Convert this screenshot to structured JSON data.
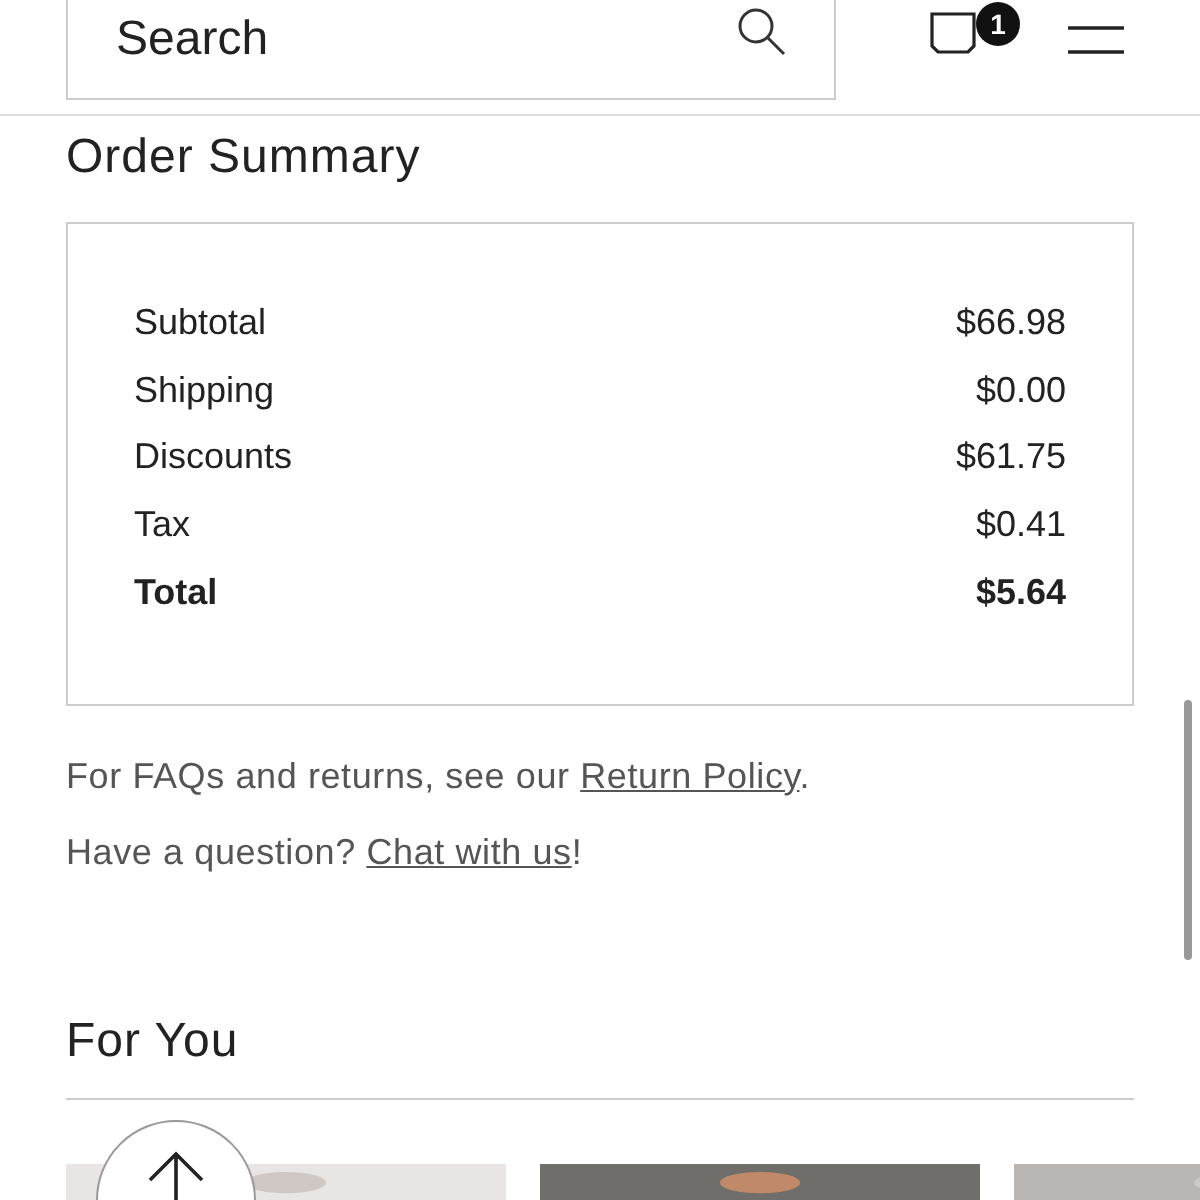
{
  "header": {
    "search": {
      "placeholder": "Search"
    },
    "cart_count": "1"
  },
  "order_summary": {
    "title": "Order Summary",
    "rows": [
      {
        "label": "Subtotal",
        "value": "$66.98",
        "kind": "normal"
      },
      {
        "label": "Shipping",
        "value": "$0.00",
        "kind": "normal"
      },
      {
        "label": "Discounts",
        "value": "$61.75",
        "kind": "normal"
      },
      {
        "label": "Tax",
        "value": "$0.41",
        "kind": "normal"
      },
      {
        "label": "Total",
        "value": "$5.64",
        "kind": "total"
      }
    ]
  },
  "help": [
    {
      "text": "For FAQs and returns, see our ",
      "link": "Return Policy",
      "after": "."
    },
    {
      "text": "Have a question? ",
      "link": "Chat with us",
      "after": "!"
    }
  ],
  "for_you": {
    "title": "For You"
  }
}
